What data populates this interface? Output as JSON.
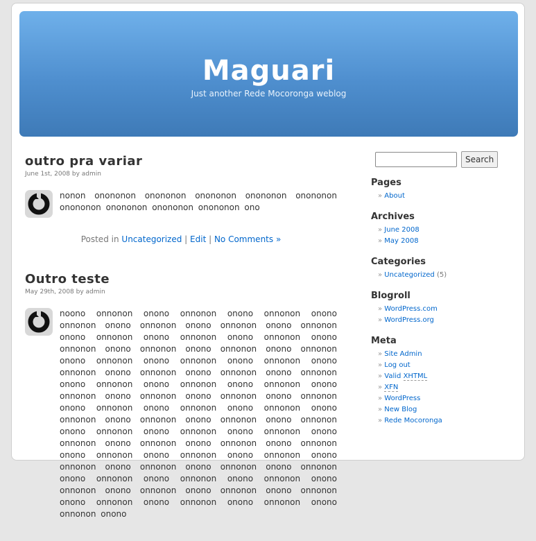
{
  "header": {
    "title": "Maguari",
    "description": "Just another Rede Mocoronga weblog"
  },
  "posts": [
    {
      "title": "outro pra variar",
      "meta": "June 1st, 2008 by admin",
      "body": "nonon onononon onononon onononon onononon onononon onononon onononon onononon onononon ono",
      "posted_in": "Posted in",
      "category": "Uncategorized",
      "sep1": " | ",
      "edit": "Edit",
      "sep2": " | ",
      "comments": "No Comments »"
    },
    {
      "title": "Outro teste",
      "meta": "May 29th, 2008 by admin",
      "body": "noono onnonon onono onnonon onono onnonon onono onnonon onono onnonon onono onnonon onono onnonon onono onnonon onono onnonon onono onnonon onono onnonon onono onnonon onono onnonon onono onnonon onono onnonon onono onnonon onono onnonon onono onnonon onono onnonon onono onnonon onono onnonon onono onnonon onono onnonon onono onnonon onono onnonon onono onnonon onono onnonon onono onnonon onono onnonon onono onnonon onono onnonon onono onnonon onono onnonon onono onnonon onono onnonon onono onnonon onono onnonon onono onnonon onono onnonon onono onnonon onono onnonon onono onnonon onono onnonon onono onnonon onono onnonon onono onnonon onono onnonon onono onnonon onono onnonon onono onnonon onono onnonon onono onnonon onono onnonon onono onnonon onono onnonon onono onnonon onono onnonon onono onnonon onono onnonon onono onnonon onono"
    }
  ],
  "sidebar": {
    "search_button": "Search",
    "search_value": "",
    "pages_title": "Pages",
    "pages": [
      "About"
    ],
    "archives_title": "Archives",
    "archives": [
      "June 2008",
      "May 2008"
    ],
    "categories_title": "Categories",
    "category_name": "Uncategorized",
    "category_count": "(5)",
    "blogroll_title": "Blogroll",
    "blogroll": [
      "WordPress.com",
      "WordPress.org"
    ],
    "meta_title": "Meta",
    "meta_site_admin": "Site Admin",
    "meta_logout": "Log out",
    "meta_valid": "Valid ",
    "meta_xhtml": "XHTML",
    "meta_xfn": "XFN",
    "meta_wordpress": "WordPress",
    "meta_new_blog": "New Blog",
    "meta_rede": "Rede Mocoronga"
  }
}
